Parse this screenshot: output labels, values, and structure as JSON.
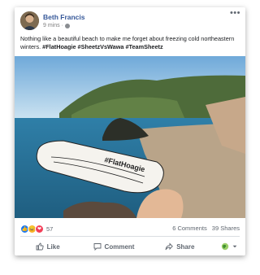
{
  "post": {
    "author": "Beth Francis",
    "time": "9 mins",
    "separator": "·",
    "more": "•••",
    "text_plain": "Nothing like a beautiful beach to make me forget about freezing cold northeastern winters. ",
    "text_hashtags": "#FlatHoagie #SheetzVsWawa #TeamSheetz",
    "photo_caption": "#FlatHoagie"
  },
  "stats": {
    "reaction_count": "57",
    "comments": "6 Comments",
    "shares": "39 Shares"
  },
  "actions": {
    "like": "Like",
    "comment": "Comment",
    "share": "Share"
  },
  "colors": {
    "link": "#365899",
    "like_blue": "#1877f2",
    "haha_yellow": "#f7b125",
    "love_red": "#f33e58"
  },
  "icons": [
    "globe-icon",
    "more-icon",
    "like-reaction-icon",
    "haha-reaction-icon",
    "love-reaction-icon",
    "thumb-up-icon",
    "comment-icon",
    "share-icon",
    "globe-profile-icon",
    "chevron-down-icon"
  ]
}
